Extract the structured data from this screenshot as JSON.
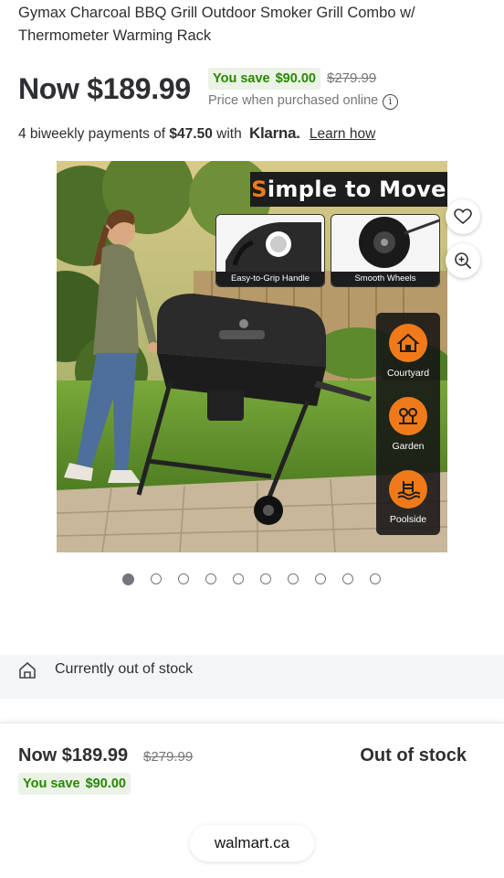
{
  "product": {
    "title": "Gymax Charcoal BBQ Grill Outdoor Smoker Grill Combo w/ Thermometer Warming Rack"
  },
  "pricing": {
    "now_price": "Now $189.99",
    "you_save_label": "You save",
    "you_save_amount": "$90.00",
    "was_price": "$279.99",
    "price_note": "Price when purchased online",
    "info_icon": "info-icon"
  },
  "klarna": {
    "prefix": "4 biweekly payments of ",
    "amount": "$47.50",
    "with": " with ",
    "brand": "Klarna.",
    "learn_how": "Learn how"
  },
  "gallery": {
    "heading_first": "S",
    "heading_rest": "imple to Move",
    "inset_1_caption": "Easy-to-Grip Handle",
    "inset_2_caption": "Smooth Wheels",
    "features": [
      {
        "label": "Courtyard",
        "icon": "house-icon"
      },
      {
        "label": "Garden",
        "icon": "garden-icon"
      },
      {
        "label": "Poolside",
        "icon": "pool-icon"
      }
    ],
    "favorite_icon": "heart-icon",
    "zoom_icon": "zoom-in-icon",
    "image_count": 10,
    "active_index": 0
  },
  "availability": {
    "message": "Currently out of stock",
    "icon": "store-icon"
  },
  "sticky_footer": {
    "now_price": "Now $189.99",
    "was_price": "$279.99",
    "you_save_label": "You save",
    "you_save_amount": "$90.00",
    "status": "Out of stock"
  },
  "browser": {
    "url": "walmart.ca"
  },
  "colors": {
    "save_green": "#2a8703",
    "save_bg": "#eaf3e6",
    "accent_orange": "#f07a1a",
    "text_dark": "#2e2f32",
    "text_muted": "#74767c"
  }
}
